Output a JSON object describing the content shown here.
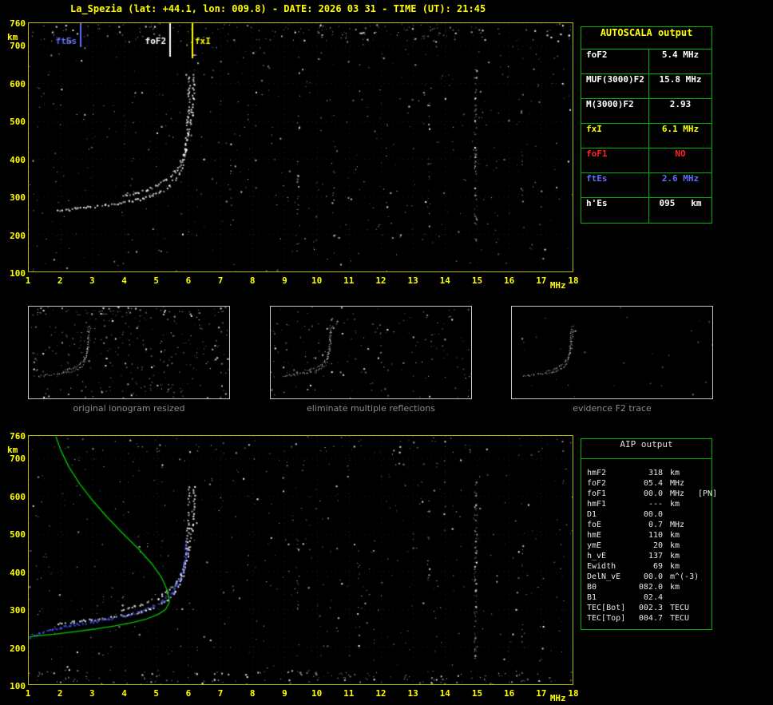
{
  "header": {
    "title": "La_Spezia (lat: +44.1, lon: 009.8) - DATE: 2026 03 31 - TIME (UT): 21:45"
  },
  "colors": {
    "axis": "#ffff00",
    "plot_border": "#b9b900",
    "table_border": "#00b400",
    "white": "#ffffff",
    "yellow": "#ffff00",
    "red": "#ff2222",
    "blue": "#5f6fff",
    "profile_green": "#00c800",
    "caption_gray": "#8c8c8c"
  },
  "autoscala": {
    "title": "AUTOSCALA output",
    "rows": [
      {
        "label": "foF2",
        "value": "5.4 MHz",
        "color": "#ffffff"
      },
      {
        "label": "MUF(3000)F2",
        "value": "15.8 MHz",
        "color": "#ffffff"
      },
      {
        "label": "M(3000)F2",
        "value": "2.93",
        "color": "#ffffff"
      },
      {
        "label": "fxI",
        "value": "6.1 MHz",
        "color": "#ffff00"
      },
      {
        "label": "foF1",
        "value": "NO",
        "color": "#ff2222"
      },
      {
        "label": "ftEs",
        "value": "2.6 MHz",
        "color": "#5f6fff"
      },
      {
        "label": "h'Es",
        "value": "095   km",
        "color": "#ffffff"
      }
    ]
  },
  "aip": {
    "title": "AIP output",
    "rows": [
      {
        "label": "hmF2",
        "value": "318",
        "unit": "km",
        "extra": ""
      },
      {
        "label": "foF2",
        "value": "05.4",
        "unit": "MHz",
        "extra": ""
      },
      {
        "label": "foF1",
        "value": "00.0",
        "unit": "MHz",
        "extra": "[PN]"
      },
      {
        "label": "hmF1",
        "value": "---",
        "unit": "km",
        "extra": ""
      },
      {
        "label": "D1",
        "value": "00.0",
        "unit": "",
        "extra": ""
      },
      {
        "label": "foE",
        "value": "0.7",
        "unit": "MHz",
        "extra": ""
      },
      {
        "label": "hmE",
        "value": "110",
        "unit": "km",
        "extra": ""
      },
      {
        "label": "ymE",
        "value": "20",
        "unit": "km",
        "extra": ""
      },
      {
        "label": "h_vE",
        "value": "137",
        "unit": "km",
        "extra": ""
      },
      {
        "label": "Ewidth",
        "value": "69",
        "unit": "km",
        "extra": ""
      },
      {
        "label": "DelN_vE",
        "value": "00.0",
        "unit": "m^(-3)",
        "extra": ""
      },
      {
        "label": "B0",
        "value": "082.0",
        "unit": "km",
        "extra": ""
      },
      {
        "label": "B1",
        "value": "02.4",
        "unit": "",
        "extra": ""
      },
      {
        "label": "TEC[Bot]",
        "value": "002.3",
        "unit": "TECU",
        "extra": ""
      },
      {
        "label": "TEC[Top]",
        "value": "004.7",
        "unit": "TECU",
        "extra": ""
      }
    ]
  },
  "thumbnails": [
    {
      "caption": "original ionogram resized"
    },
    {
      "caption": "eliminate multiple reflections"
    },
    {
      "caption": "evidence F2 trace"
    }
  ],
  "chart_data": [
    {
      "id": "main_ionogram",
      "type": "scatter",
      "title": "scaled ionogram with autoscaled characteristics",
      "xlabel": "MHz",
      "ylabel": "km",
      "xlim": [
        1,
        18
      ],
      "ylim": [
        100,
        760
      ],
      "xticks": [
        1,
        2,
        3,
        4,
        5,
        6,
        7,
        8,
        9,
        10,
        11,
        12,
        13,
        14,
        15,
        16,
        17,
        18
      ],
      "yticks": [
        100,
        200,
        300,
        400,
        500,
        600,
        700,
        760
      ],
      "grid": true,
      "markers": [
        {
          "label": "ftEs",
          "freq": 2.6,
          "color": "#5f6fff",
          "len": 30
        },
        {
          "label": "foF2",
          "freq": 5.4,
          "color": "#ffffff",
          "len": 42
        },
        {
          "label": "fxI",
          "freq": 6.1,
          "color": "#ffff00",
          "len": 44
        }
      ],
      "traces": [
        {
          "name": "F2 ordinary trace",
          "color": "#ffffff",
          "points": [
            [
              1.9,
              262
            ],
            [
              2.4,
              268
            ],
            [
              2.9,
              273
            ],
            [
              3.4,
              278
            ],
            [
              3.9,
              284
            ],
            [
              4.4,
              292
            ],
            [
              4.8,
              302
            ],
            [
              5.1,
              314
            ],
            [
              5.35,
              328
            ],
            [
              5.55,
              346
            ],
            [
              5.7,
              366
            ],
            [
              5.8,
              392
            ],
            [
              5.87,
              424
            ],
            [
              5.92,
              464
            ],
            [
              5.96,
              514
            ],
            [
              5.99,
              578
            ],
            [
              6.01,
              625
            ]
          ]
        },
        {
          "name": "F2 extraordinary trace",
          "color": "#ffffff",
          "points": [
            [
              3.9,
              301
            ],
            [
              4.3,
              309
            ],
            [
              4.7,
              319
            ],
            [
              5.0,
              331
            ],
            [
              5.3,
              347
            ],
            [
              5.55,
              367
            ],
            [
              5.75,
              393
            ],
            [
              5.9,
              426
            ],
            [
              6.0,
              466
            ],
            [
              6.08,
              516
            ],
            [
              6.13,
              578
            ],
            [
              6.16,
              626
            ]
          ]
        }
      ],
      "noise": {
        "random": 520,
        "hbands": [
          {
            "km": [
              712,
              758
            ],
            "count": 170
          }
        ],
        "vstripes": [
          {
            "freq": 14.95,
            "km": [
              180,
              640
            ],
            "count": 70
          },
          {
            "freq": 9.4,
            "km": [
              150,
              520
            ],
            "count": 18
          },
          {
            "freq": 13.5,
            "km": [
              200,
              600
            ],
            "count": 15
          },
          {
            "freq": 10.5,
            "km": [
              150,
              560
            ],
            "count": 12
          },
          {
            "freq": 16.4,
            "km": [
              200,
              600
            ],
            "count": 10
          },
          {
            "freq": 7.3,
            "km": [
              140,
              460
            ],
            "count": 8
          },
          {
            "freq": 12.2,
            "km": [
              160,
              520
            ],
            "count": 8
          }
        ]
      }
    },
    {
      "id": "profile_ionogram",
      "type": "scatter",
      "title": "restored trace and electron density profile",
      "xlabel": "MHz",
      "ylabel": "km",
      "xlim": [
        1,
        18
      ],
      "ylim": [
        100,
        760
      ],
      "xticks": [
        1,
        2,
        3,
        4,
        5,
        6,
        7,
        8,
        9,
        10,
        11,
        12,
        13,
        14,
        15,
        16,
        17,
        18
      ],
      "yticks": [
        100,
        200,
        300,
        400,
        500,
        600,
        700,
        760
      ],
      "grid": true,
      "traces_from": "main_ionogram",
      "restored_trace": {
        "name": "restored O-trace",
        "color": "#4455ff",
        "points": [
          [
            1.0,
            225
          ],
          [
            1.35,
            237
          ],
          [
            1.7,
            246
          ],
          [
            2.0,
            252
          ],
          [
            2.5,
            261
          ],
          [
            3.0,
            268
          ],
          [
            3.5,
            275
          ],
          [
            4.0,
            284
          ],
          [
            4.5,
            296
          ],
          [
            4.9,
            310
          ],
          [
            5.2,
            325
          ],
          [
            5.45,
            343
          ],
          [
            5.65,
            368
          ],
          [
            5.8,
            400
          ],
          [
            5.88,
            440
          ],
          [
            5.93,
            488
          ]
        ]
      },
      "profile": {
        "name": "electron density profile",
        "color": "#00c800",
        "topside": [
          [
            1.85,
            758
          ],
          [
            2.0,
            722
          ],
          [
            2.25,
            678
          ],
          [
            2.6,
            632
          ],
          [
            3.0,
            588
          ],
          [
            3.45,
            544
          ],
          [
            3.95,
            500
          ],
          [
            4.45,
            458
          ],
          [
            4.85,
            420
          ],
          [
            5.15,
            384
          ],
          [
            5.33,
            350
          ],
          [
            5.4,
            318
          ]
        ],
        "bottomside": [
          [
            5.4,
            318
          ],
          [
            5.28,
            299
          ],
          [
            5.05,
            286
          ],
          [
            4.7,
            274
          ],
          [
            4.25,
            264
          ],
          [
            3.7,
            255
          ],
          [
            3.1,
            247
          ],
          [
            2.45,
            240
          ],
          [
            1.8,
            233
          ],
          [
            1.3,
            229
          ],
          [
            1.02,
            226
          ]
        ]
      },
      "noise": {
        "random": 500,
        "hbands": [
          {
            "km": [
              100,
              138
            ],
            "count": 150
          },
          {
            "km": [
              712,
              758
            ],
            "count": 60
          }
        ],
        "vstripes": [
          {
            "freq": 14.95,
            "km": [
              170,
              640
            ],
            "count": 70
          },
          {
            "freq": 9.4,
            "km": [
              150,
              520
            ],
            "count": 15
          },
          {
            "freq": 13.5,
            "km": [
              200,
              600
            ],
            "count": 12
          },
          {
            "freq": 16.4,
            "km": [
              200,
              560
            ],
            "count": 10
          },
          {
            "freq": 11.3,
            "km": [
              150,
              500
            ],
            "count": 8
          }
        ]
      }
    },
    {
      "id": "thumb_original",
      "type": "scatter",
      "xlim": [
        1,
        18
      ],
      "ylim": [
        100,
        760
      ],
      "traces_from": "main_ionogram",
      "noise": {
        "random": 300,
        "hbands": [
          {
            "km": [
              700,
              760
            ],
            "count": 40
          }
        ]
      }
    },
    {
      "id": "thumb_multiples",
      "type": "scatter",
      "xlim": [
        1,
        18
      ],
      "ylim": [
        100,
        760
      ],
      "traces_from": "main_ionogram",
      "noise": {
        "random": 180
      }
    },
    {
      "id": "thumb_f2",
      "type": "scatter",
      "xlim": [
        1,
        18
      ],
      "ylim": [
        100,
        760
      ],
      "traces_from": "main_ionogram",
      "noise": {
        "random": 28
      }
    }
  ]
}
